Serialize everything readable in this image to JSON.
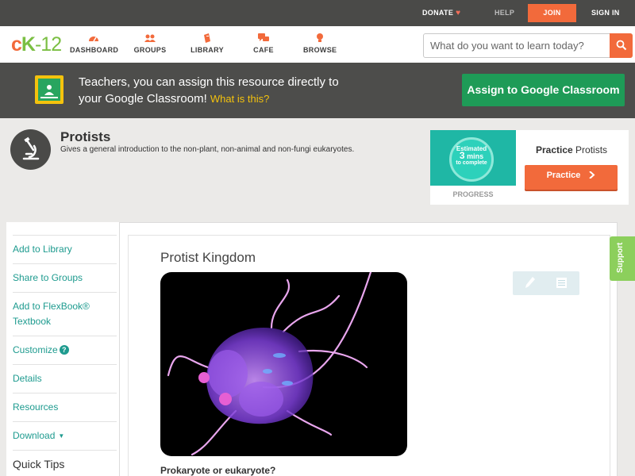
{
  "topbar": {
    "donate": "DONATE",
    "help": "HELP",
    "join": "JOIN",
    "signin": "SIGN IN"
  },
  "nav": {
    "logo": {
      "c": "c",
      "k": "K",
      "d": "-",
      "n": "12"
    },
    "items": [
      {
        "label": "DASHBOARD",
        "icon": "dashboard-icon"
      },
      {
        "label": "GROUPS",
        "icon": "groups-icon"
      },
      {
        "label": "LIBRARY",
        "icon": "library-icon"
      },
      {
        "label": "CAFE",
        "icon": "cafe-icon"
      },
      {
        "label": "BROWSE",
        "icon": "browse-icon"
      }
    ],
    "search_placeholder": "What do you want to learn today?"
  },
  "classroom_banner": {
    "line1": "Teachers, you can assign this resource directly to",
    "line2": "your Google Classroom!",
    "what_is_this": "What is this?",
    "button": "Assign to Google Classroom"
  },
  "concept": {
    "title": "Protists",
    "description": "Gives a general introduction to the non-plant, non-animal and non-fungi eukaryotes."
  },
  "practice_card": {
    "estimated": "Estimated",
    "mins_value": "3",
    "mins_unit": "mins",
    "to_complete": "to complete",
    "progress_label": "PROGRESS",
    "title_bold": "Practice",
    "title_rest": "Protists",
    "button": "Practice"
  },
  "sidebar": {
    "items": [
      "Add to Library",
      "Share to Groups",
      "Add to FlexBook®",
      "Textbook",
      "Customize",
      "Details",
      "Resources",
      "Download",
      "Quick Tips"
    ]
  },
  "main": {
    "title": "Protist Kingdom",
    "caption": "Prokaryote or eukaryote?"
  },
  "support_tab": "Support",
  "colors": {
    "accent_orange": "#f26a3b",
    "accent_green": "#1e9b57",
    "link_teal": "#1e9b8f",
    "logo_green": "#7bbf43"
  }
}
